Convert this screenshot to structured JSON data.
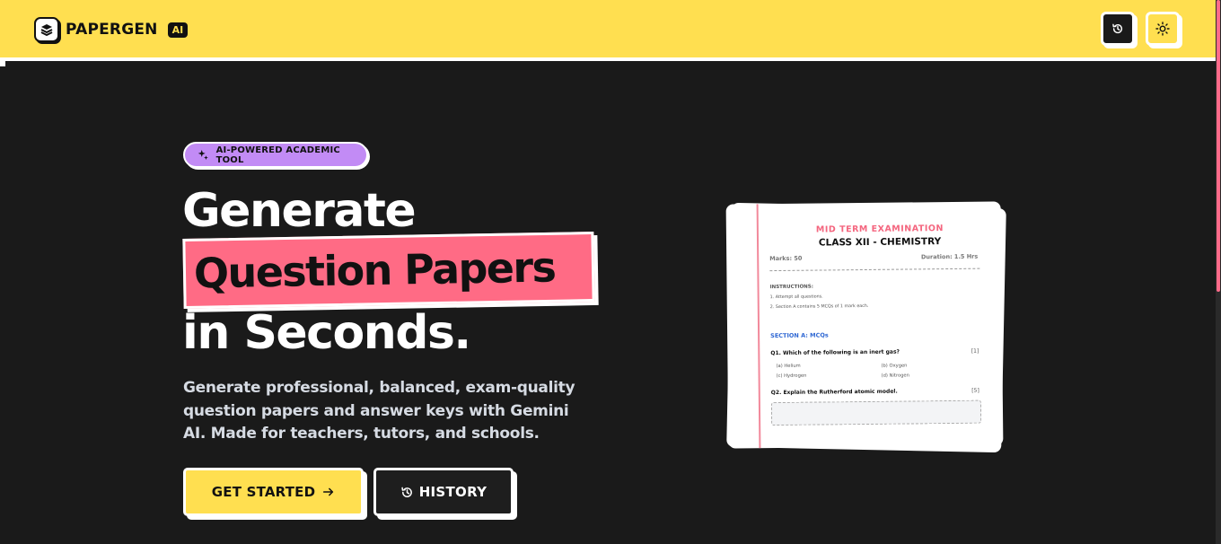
{
  "app": {
    "name": "PAPERGEN",
    "badge": "AI"
  },
  "colors": {
    "brand_yellow": "#ffdf50",
    "highlight_pink": "#ff6b85",
    "badge_purple": "#c28bf5",
    "background": "#1a1a1a"
  },
  "header": {
    "history_icon": "history-icon",
    "theme_icon": "sun-icon"
  },
  "hero": {
    "badge_icon": "sparkles-icon",
    "badge_label": "AI-POWERED ACADEMIC TOOL",
    "title_line1": "Generate",
    "title_highlight": "Question Papers",
    "title_line3": "in Seconds.",
    "description": "Generate professional, balanced, exam-quality question papers and answer keys with Gemini AI. Made for teachers, tutors, and schools.",
    "cta_primary": "GET STARTED",
    "cta_primary_icon": "arrow-right-icon",
    "cta_secondary": "HISTORY",
    "cta_secondary_icon": "history-icon"
  },
  "preview": {
    "exam_name": "MID TERM EXAMINATION",
    "class_subject": "CLASS XII - CHEMISTRY",
    "marks": "Marks: 50",
    "duration": "Duration: 1.5 Hrs",
    "instructions_title": "INSTRUCTIONS:",
    "instructions": [
      "1. Attempt all questions.",
      "2. Section A contains 5 MCQs of 1 mark each."
    ],
    "section_title": "SECTION A: MCQs",
    "q1": {
      "text": "Q1. Which of the following is an inert gas?",
      "marks": "[1]",
      "options": [
        "(a) Helium",
        "(b) Oxygen",
        "(c) Hydrogen",
        "(d) Nitrogen"
      ]
    },
    "q2": {
      "text": "Q2. Explain the Rutherford atomic model.",
      "marks": "[5]"
    }
  }
}
